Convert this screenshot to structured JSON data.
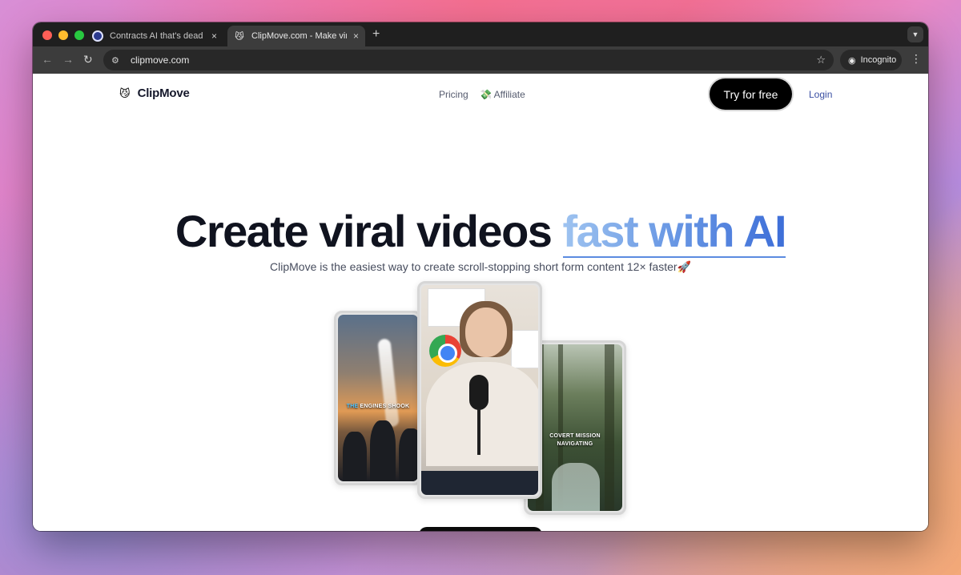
{
  "browser": {
    "tabs": [
      {
        "title": "Contracts AI that's dead easy",
        "active": false,
        "favicon": "circle-logo-icon"
      },
      {
        "title": "ClipMove.com - Make viral videos",
        "active": true,
        "favicon": "cat-emoji-icon"
      }
    ],
    "new_tab_symbol": "+",
    "close_symbol": "×",
    "address_bar": {
      "url": "clipmove.com"
    },
    "incognito_label": "Incognito",
    "colors": {
      "chrome_dark": "#1f1f1f",
      "toolbar": "#3c3c3c"
    }
  },
  "site": {
    "logo": {
      "emoji": "😼",
      "text": "ClipMove"
    },
    "nav": {
      "pricing": "Pricing",
      "affiliate": "💸 Affiliate"
    },
    "cta_label": "Try for free",
    "login_label": "Login"
  },
  "hero": {
    "title_main": "Create viral videos ",
    "title_accent": "fast with AI",
    "subtitle": "ClipMove is the easiest way to create scroll-stopping short form content 12× faster🚀",
    "colors": {
      "title": "#10131f",
      "accent_start": "#9ec3f0",
      "accent_end": "#3d6ed8"
    }
  },
  "phones": {
    "left": {
      "caption_highlight": "THE",
      "caption_rest": " ENGINES SHOOK"
    },
    "right": {
      "caption_line1": "COVERT MISSION",
      "caption_line2": "NAVIGATING"
    }
  }
}
